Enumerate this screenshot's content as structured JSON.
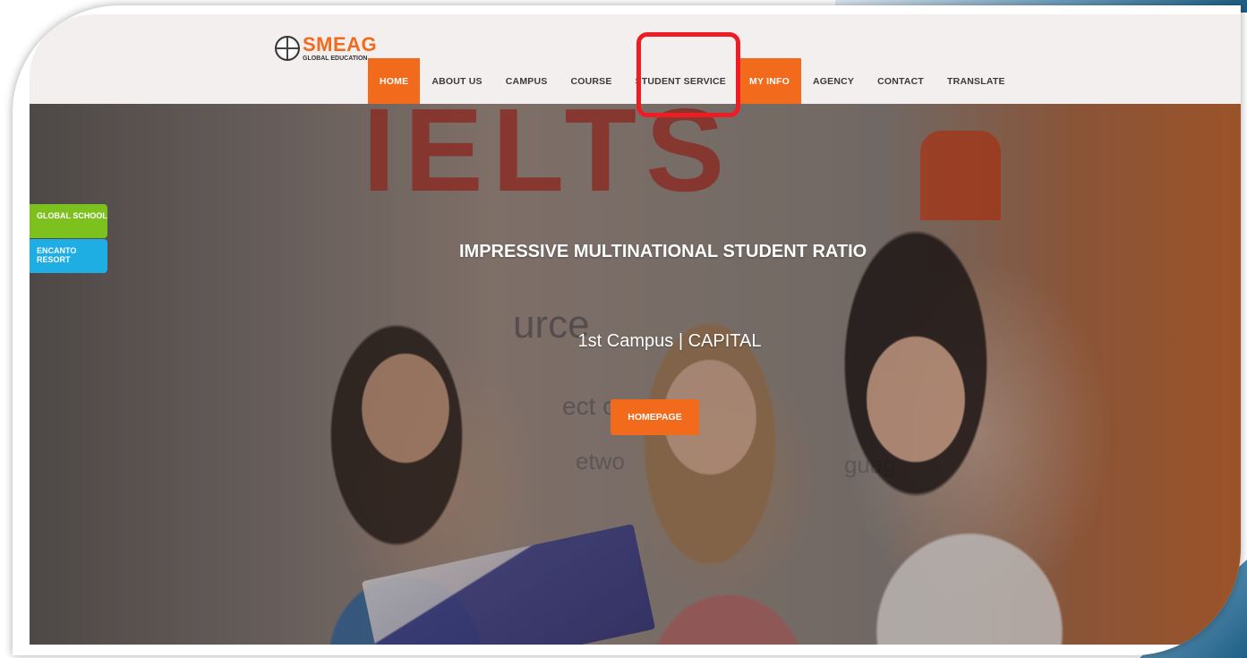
{
  "logo": {
    "name": "SMEAG",
    "tagline": "GLOBAL EDUCATION"
  },
  "nav": {
    "items": [
      {
        "label": "HOME",
        "state": "active"
      },
      {
        "label": "ABOUT US"
      },
      {
        "label": "CAMPUS"
      },
      {
        "label": "COURSE"
      },
      {
        "label": "STUDENT SERVICE",
        "annotation": "highlighted-with-red-box"
      },
      {
        "label": "MY INFO",
        "state": "highlight"
      },
      {
        "label": "AGENCY"
      },
      {
        "label": "CONTACT"
      },
      {
        "label": "TRANSLATE"
      }
    ]
  },
  "side_tabs": {
    "global_school": "GLOBAL SCHOOL",
    "encanto_resort": "ENCANTO RESORT"
  },
  "hero": {
    "title": "IMPRESSIVE MULTINATIONAL STUDENT RATIO",
    "subtitle": "1st Campus | CAPITAL",
    "button_label": "HOMEPAGE",
    "background_text": {
      "sign": "IELTS",
      "line1": "urce",
      "line2": "ect o",
      "line3": "etwo",
      "line4": "guag"
    }
  },
  "colors": {
    "accent_orange": "#f26b1d",
    "annotation_red": "#ee1c25",
    "global_school_green": "#7dc11f",
    "encanto_blue": "#1eaee4"
  }
}
